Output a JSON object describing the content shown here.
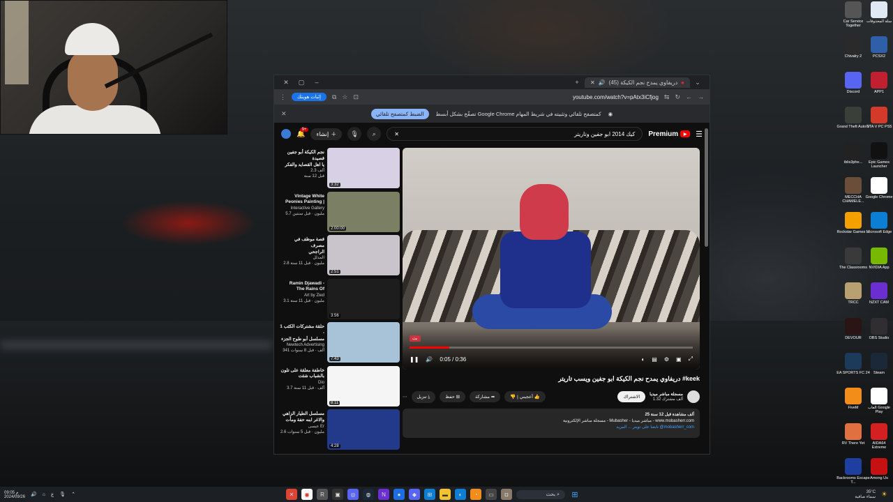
{
  "browser": {
    "tab_title": "(45) دريفاوي يمدح نجم الكيكة",
    "url": "youtube.com/watch?v=pAtx3iCfjog",
    "profile_button": "إثبات هويتك",
    "notice_text": "تصفّح بشكل أبسط Google Chrome كمتصفح تلقائي وتثبيته في شريط المهام",
    "notice_button": "الضبط كمتصفح تلقائي"
  },
  "youtube": {
    "logo": "Premium",
    "search_query": "كيك 2014 ابو جفين وتاريتر",
    "create_label": "إنشاء",
    "notifications": "9+",
    "related": [
      {
        "title": "نجم الكيكة أبو جفين قصيدة",
        "channel": "يا اهل القصايد والفكر",
        "meta": "2.3 ألف",
        "age": "قبل 12 سنة",
        "duration": "3:32",
        "color": "#d8d1e6"
      },
      {
        "title": "Vintage White",
        "channel": "Peonies Painting |",
        "meta": "Interactive Gallery",
        "age": "5.7 مليون · قبل سنتين",
        "duration": "2:00:00",
        "color": "#7b7f63"
      },
      {
        "title": "قصة موظف في مصرف",
        "channel": "الراجحي",
        "meta": "المدلل",
        "age": "2.8 مليون · قبل 11 سنة",
        "duration": "2:51",
        "color": "#c9c4cb"
      },
      {
        "title": "Ramin Djawadi -",
        "channel": "The Rains Of",
        "meta": "Art by Zied",
        "age": "3.1 مليون · قبل 11 سنة",
        "duration": "3:56",
        "color": "#1d1d1d"
      },
      {
        "title": "حلقة مشتركات الكئب 1 -",
        "channel": "مسلسل أبو طوح الجزء",
        "meta": "Newtech Advertising",
        "age": "341 ألف · قبل 8 سنوات",
        "duration": "7:43",
        "color": "#a8c2d8"
      },
      {
        "title": "خاطفة معلقة على تلون",
        "channel": "بالشباب شئت",
        "meta": "Dio",
        "age": "3.7 ألف · قبل 11 سنة",
        "duration": "8:11",
        "color": "#f5f5f5"
      },
      {
        "title": "مسلسل الطيار الزاهي",
        "channel": "والاغر ابنه حفة ومأت",
        "meta": "عيسى Er",
        "age": "2.6 مليون · قبل 5 سنوات",
        "duration": "4:28",
        "color": "#233a8a"
      }
    ],
    "player": {
      "time": "0:05 / 0:36",
      "progress": 0.14,
      "live_badge": "بث"
    },
    "video_title": "دريفاوي يمدح نجم الكيكة ابو جفين ويسب تاريتر #keek",
    "actions": {
      "like": "أعجبني",
      "share": "مشاركة",
      "save": "حفظ",
      "download": "تنزيل",
      "subscribe": "الاشتراك"
    },
    "channel": {
      "name": "مسجلة مباشر ميديا",
      "subs": "1.32 ألف مشترك"
    },
    "description": {
      "stats": "25 ألف مشاهدة قبل 12 سنة",
      "line1": "مسجلة مباشر الإلكترونية - Mubasher - مباشر ميديا - www.mobasherr.com",
      "line2": "تابعنا على تويتر ... المزيد @mobasherr_com"
    }
  },
  "desktop_icons": {
    "col1": [
      {
        "label": "Car Service Together",
        "color": "#555"
      },
      {
        "label": "Chivalry 2",
        "color": "#2a2a2a"
      },
      {
        "label": "Discord",
        "color": "#5865f2"
      },
      {
        "label": "Grand Theft Auto V",
        "color": "#3a3f3a"
      },
      {
        "label": "iblis3phe...",
        "color": "#222"
      },
      {
        "label": "MECCHA CHAMELE...",
        "color": "#6a4e3a"
      },
      {
        "label": "Rockstar Games ...",
        "color": "#f4a000"
      },
      {
        "label": "The Classrooms",
        "color": "#3a3a3a"
      },
      {
        "label": "TRCC",
        "color": "#b8a070"
      },
      {
        "label": "DEVOUR",
        "color": "#2b1414"
      },
      {
        "label": "EA SPORTS FC 24",
        "color": "#1c3a5a"
      },
      {
        "label": "FiveM",
        "color": "#f28d1a"
      },
      {
        "label": "RV There Yet",
        "color": "#e07040"
      },
      {
        "label": "Backrooms Escape T...",
        "color": "#1e3fa0"
      }
    ],
    "col2": [
      {
        "label": "سلة المحذوفات",
        "color": "#dfe9f5"
      },
      {
        "label": "PCSX2",
        "color": "#2f5fa8"
      },
      {
        "label": "APP1",
        "color": "#c02030"
      },
      {
        "label": "GTA V PC PS5",
        "color": "#d43a2a"
      },
      {
        "label": "Epic Games Launcher",
        "color": "#111"
      },
      {
        "label": "Google Chrome",
        "color": "#ffffff"
      },
      {
        "label": "Microsoft Edge",
        "color": "#0c7fd4"
      },
      {
        "label": "NVIDIA App",
        "color": "#76b900"
      },
      {
        "label": "NZXT CAM",
        "color": "#6b2fd1"
      },
      {
        "label": "OBS Studio",
        "color": "#302e31"
      },
      {
        "label": "Steam",
        "color": "#1b2838"
      },
      {
        "label": "العاب Google Play",
        "color": "#ffffff"
      },
      {
        "label": "AIDA64 Extreme",
        "color": "#d42020"
      },
      {
        "label": "Among Us",
        "color": "#c51111"
      }
    ]
  },
  "taskbar": {
    "search": "بحث",
    "clock": "09:05 م",
    "date": "2024/09/26",
    "weather": "35°C",
    "weather_desc": "سماء صافية"
  }
}
